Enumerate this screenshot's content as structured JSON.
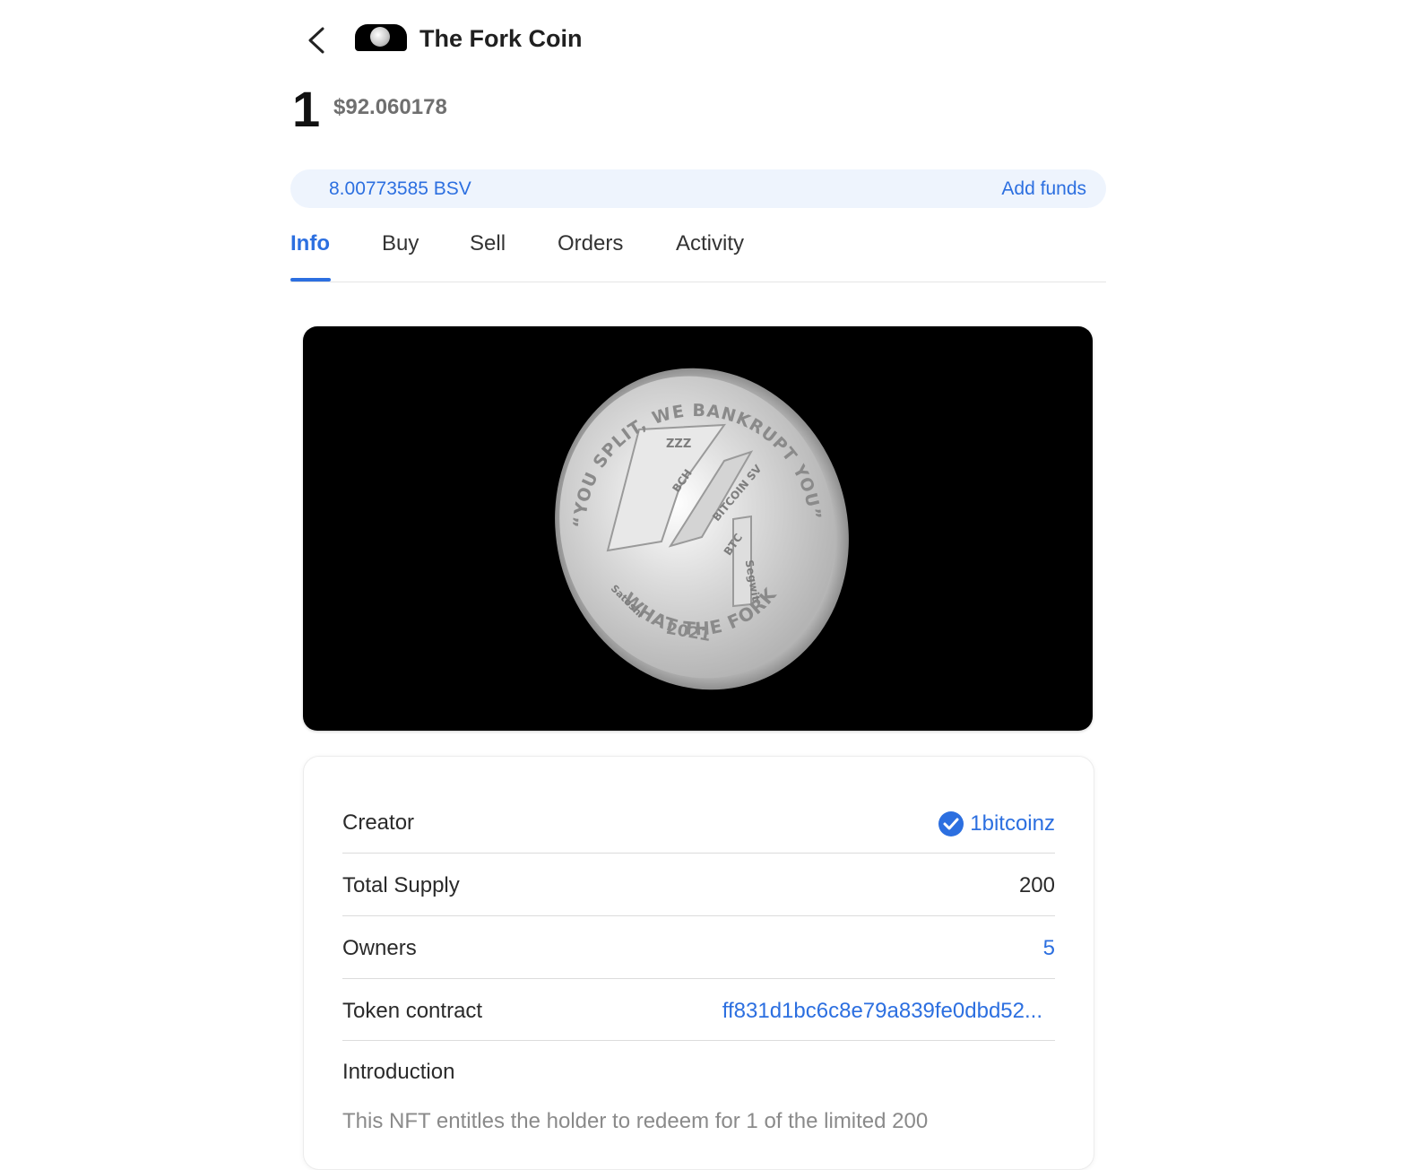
{
  "header": {
    "back_icon": "chevron-left-icon",
    "title": "The Fork Coin"
  },
  "holding": {
    "amount": "1",
    "usd_value": "$92.060178"
  },
  "wallet": {
    "balance": "8.00773585 BSV",
    "add_funds_label": "Add funds"
  },
  "tabs": [
    {
      "label": "Info",
      "active": true
    },
    {
      "label": "Buy",
      "active": false
    },
    {
      "label": "Sell",
      "active": false
    },
    {
      "label": "Orders",
      "active": false
    },
    {
      "label": "Activity",
      "active": false
    }
  ],
  "media": {
    "coin_text_top": "“YOU SPLIT, WE BANKRUPT YOU”",
    "coin_text_bottom": "WHAT THE FORK",
    "coin_year": "2021",
    "coin_labels": [
      "ZZZ",
      "BCH",
      "BITCOIN SV",
      "BTC",
      "Segwit",
      "Satoshi"
    ]
  },
  "details": {
    "creator_label": "Creator",
    "creator_value": "1bitcoinz",
    "creator_icon": "verified-check-icon",
    "supply_label": "Total Supply",
    "supply_value": "200",
    "owners_label": "Owners",
    "owners_value": "5",
    "contract_label": "Token contract",
    "contract_value": "ff831d1bc6c8e79a839fe0dbd52...",
    "intro_label": "Introduction",
    "intro_text": "This NFT entitles the holder to redeem for 1 of the limited 200"
  },
  "colors": {
    "accent": "#2c6fe0",
    "funds_bar_bg": "#eef4fd",
    "media_bg": "#000000"
  }
}
